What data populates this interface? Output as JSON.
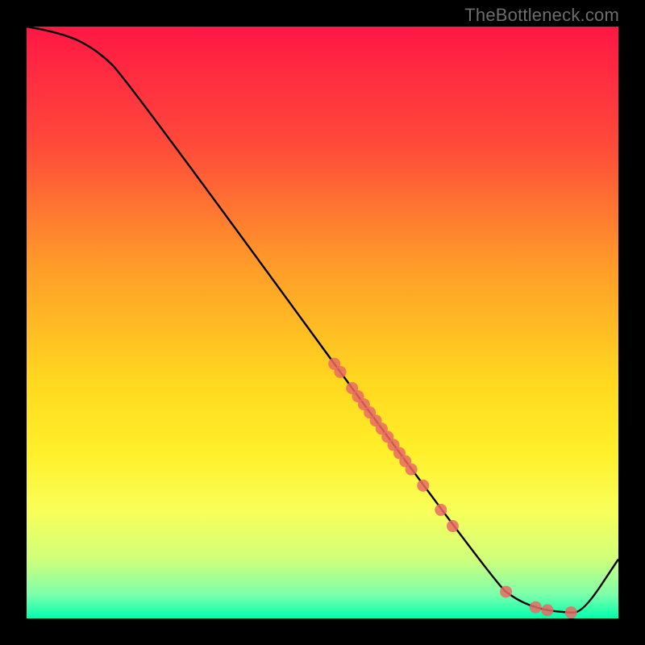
{
  "watermark": "TheBottleneck.com",
  "chart_data": {
    "type": "line",
    "title": "",
    "xlabel": "",
    "ylabel": "",
    "xlim": [
      0,
      100
    ],
    "ylim": [
      0,
      100
    ],
    "grid": false,
    "curve": [
      {
        "x": 0,
        "y": 100
      },
      {
        "x": 6,
        "y": 99
      },
      {
        "x": 12,
        "y": 96
      },
      {
        "x": 17,
        "y": 91
      },
      {
        "x": 79,
        "y": 6
      },
      {
        "x": 83,
        "y": 3
      },
      {
        "x": 87,
        "y": 1.5
      },
      {
        "x": 91,
        "y": 1
      },
      {
        "x": 94,
        "y": 1
      },
      {
        "x": 100,
        "y": 10
      }
    ],
    "markers_on_curve_x": [
      52,
      53,
      55,
      56,
      57,
      58,
      59,
      60,
      61,
      62,
      63,
      64,
      65,
      67,
      70,
      72,
      81,
      86,
      88,
      92
    ],
    "marker_color": "#ea6a64",
    "line_color": "#000000",
    "gradient_stops": [
      {
        "offset": 0.0,
        "color": "#ff1744"
      },
      {
        "offset": 0.2,
        "color": "#ff4a3a"
      },
      {
        "offset": 0.4,
        "color": "#ff9a29"
      },
      {
        "offset": 0.6,
        "color": "#ffd81f"
      },
      {
        "offset": 0.72,
        "color": "#fff02a"
      },
      {
        "offset": 0.82,
        "color": "#f8ff5a"
      },
      {
        "offset": 0.9,
        "color": "#d0ff7a"
      },
      {
        "offset": 0.96,
        "color": "#7cffab"
      },
      {
        "offset": 1.0,
        "color": "#00ffae"
      }
    ]
  }
}
